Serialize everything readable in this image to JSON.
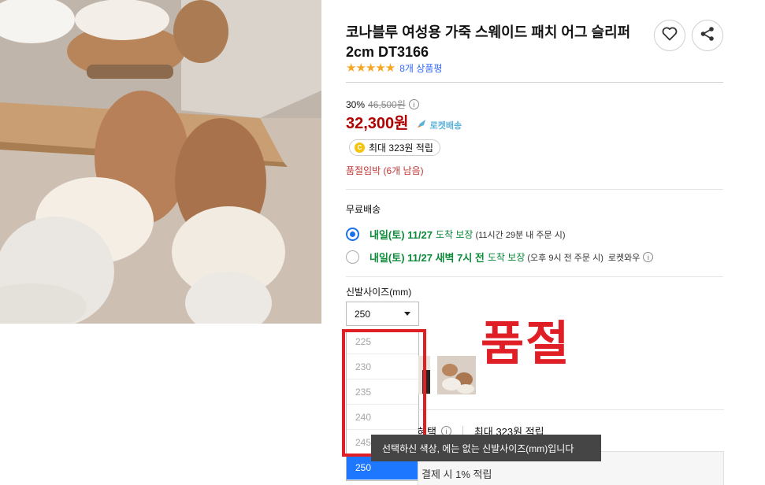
{
  "product": {
    "title": "코나블루 여성용 가죽 스웨이드 패치 어그 슬리퍼 2cm DT3166",
    "rating_stars": "★★★★★",
    "rating": 4.5,
    "review_count_text": "8개 상품평"
  },
  "pricing": {
    "discount_rate": "30%",
    "original_price": "46,500원",
    "sale_price": "32,300원",
    "delivery_badge": "로켓배송",
    "cash_reward": "최대 323원 적립",
    "coin_symbol": "C",
    "stock_warning": "품절임박 (6개 남음)"
  },
  "shipping": {
    "free_label": "무료배송",
    "options": [
      {
        "date": "내일(토) 11/27",
        "guarantee": "도착 보장",
        "note": "(11시간 29분 내 주문 시)",
        "selected": true
      },
      {
        "date": "내일(토) 11/27 새벽 7시 전",
        "guarantee": "도착 보장",
        "note": "(오후 9시 전 주문 시)",
        "extra": "로켓와우",
        "selected": false
      }
    ]
  },
  "size_selector": {
    "label": "신발사이즈(mm)",
    "selected_value": "250",
    "options": [
      "225",
      "230",
      "235",
      "240",
      "245",
      "250"
    ]
  },
  "overlay": {
    "soldout_text": "품절",
    "tooltip": "선택하신 색상, 에는 없는 신발사이즈(mm)입니다"
  },
  "benefits": {
    "label_fragment": "혜택",
    "reward": "최대 323원 적립",
    "card_text": "결제 시 1% 적립"
  },
  "icons": {
    "favorite": "heart-icon",
    "share": "share-icon",
    "info": "info-icon",
    "rocket": "rocket-icon"
  },
  "colors": {
    "price": "#ae0000",
    "delivery_green": "#0c8a3a",
    "link_blue": "#346aff",
    "annotation_red": "#e01e26",
    "selected_blue": "#1e78ff"
  }
}
